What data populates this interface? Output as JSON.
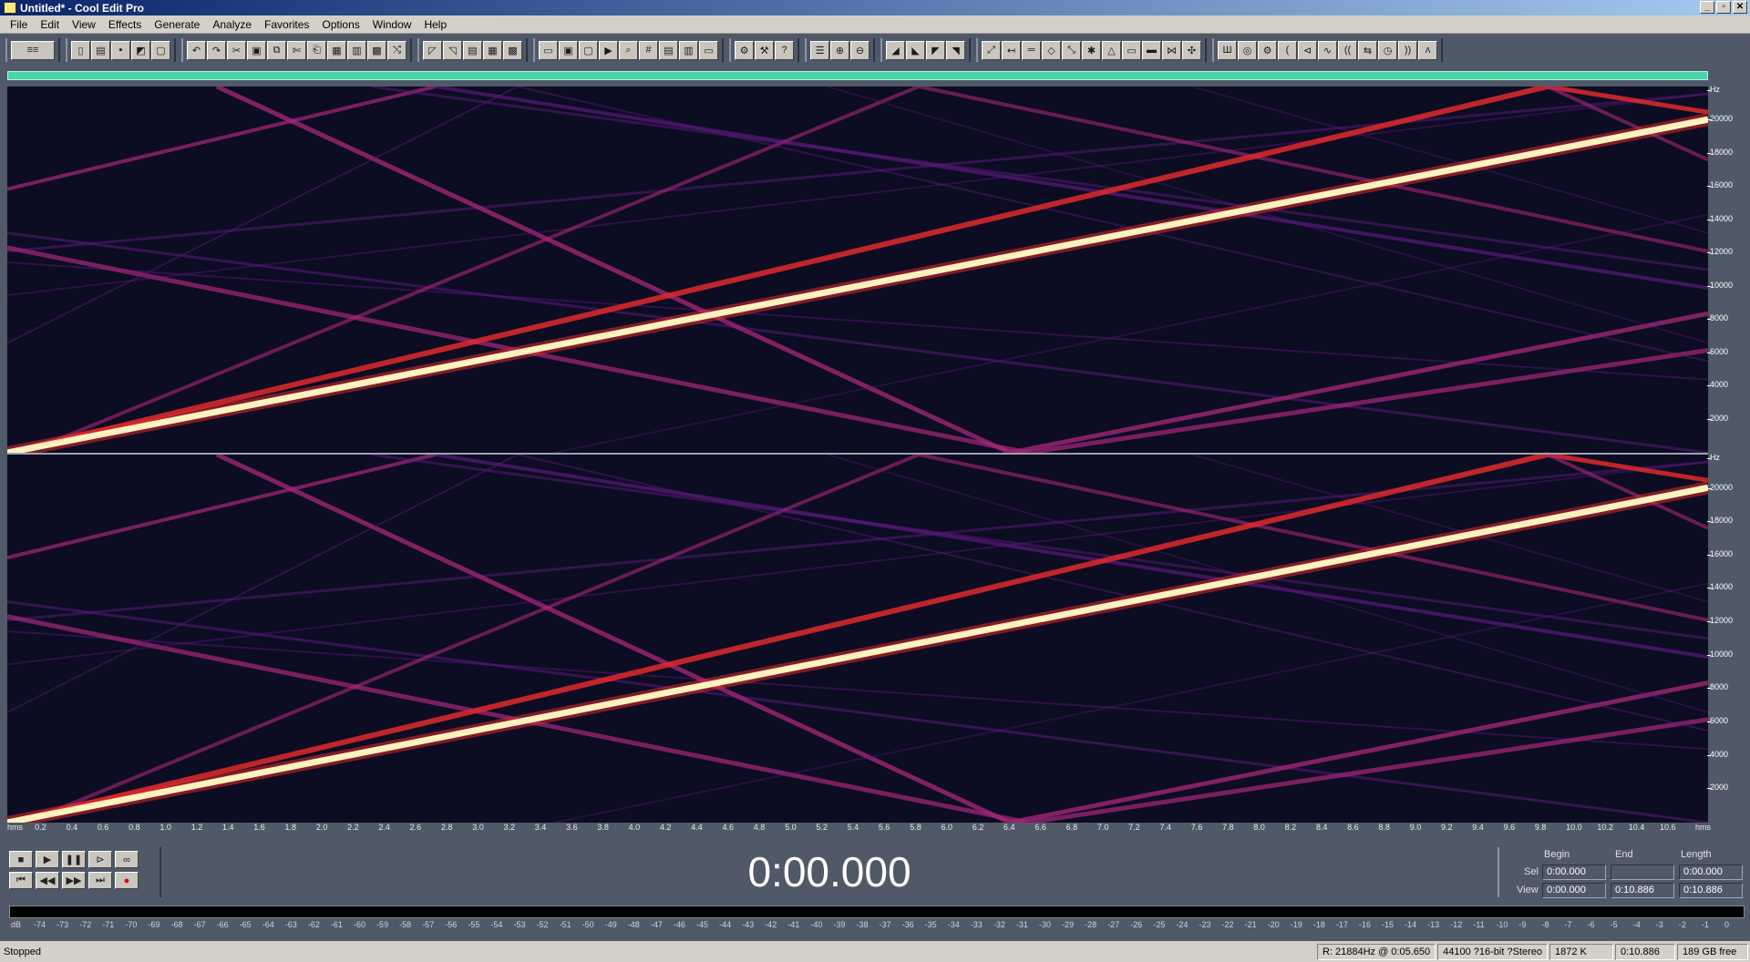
{
  "window": {
    "title": "Untitled* - Cool Edit Pro",
    "min": "_",
    "restore": "▫",
    "close": "✕"
  },
  "menu": [
    "File",
    "Edit",
    "View",
    "Effects",
    "Generate",
    "Analyze",
    "Favorites",
    "Options",
    "Window",
    "Help"
  ],
  "toolbar_groups": [
    [
      {
        "icon": "multitrack-icon",
        "glyph": "≡≡"
      }
    ],
    [
      {
        "icon": "new-file-icon",
        "glyph": "▯"
      },
      {
        "icon": "open-file-icon",
        "glyph": "▤"
      },
      {
        "icon": "save-icon",
        "glyph": "▪"
      },
      {
        "icon": "save-as-icon",
        "glyph": "◩"
      },
      {
        "icon": "close-file-icon",
        "glyph": "▢"
      }
    ],
    [
      {
        "icon": "undo-icon",
        "glyph": "↶"
      },
      {
        "icon": "redo-icon",
        "glyph": "↷"
      },
      {
        "icon": "cut-icon",
        "glyph": "✂"
      },
      {
        "icon": "copy-icon",
        "glyph": "▣"
      },
      {
        "icon": "copy-new-icon",
        "glyph": "⧉"
      },
      {
        "icon": "trim-icon",
        "glyph": "✄"
      },
      {
        "icon": "paste-icon",
        "glyph": "⎗"
      },
      {
        "icon": "paste-new-icon",
        "glyph": "▦"
      },
      {
        "icon": "mix-paste-icon",
        "glyph": "▥"
      },
      {
        "icon": "clipboard-icon",
        "glyph": "▩"
      },
      {
        "icon": "mix-icon",
        "glyph": "⤭"
      }
    ],
    [
      {
        "icon": "envelope-icon",
        "glyph": "◸"
      },
      {
        "icon": "fade-icon",
        "glyph": "◹"
      },
      {
        "icon": "split-icon",
        "glyph": "▤"
      },
      {
        "icon": "channel-icon",
        "glyph": "▦"
      },
      {
        "icon": "grid-icon",
        "glyph": "▩"
      }
    ],
    [
      {
        "icon": "view-waveform-icon",
        "glyph": "▭"
      },
      {
        "icon": "view-spectral-icon",
        "glyph": "▣"
      },
      {
        "icon": "view-info-icon",
        "glyph": "▢"
      },
      {
        "icon": "play-preview-icon",
        "glyph": "▶"
      },
      {
        "icon": "zoom-tool-icon",
        "glyph": "⌕"
      },
      {
        "icon": "sample-rate-icon",
        "glyph": "#"
      },
      {
        "icon": "bit-depth-icon",
        "glyph": "▤"
      },
      {
        "icon": "stats-icon",
        "glyph": "▥"
      },
      {
        "icon": "blank-icon",
        "glyph": "▭"
      }
    ],
    [
      {
        "icon": "settings-icon",
        "glyph": "⚙"
      },
      {
        "icon": "tools-icon",
        "glyph": "⚒"
      },
      {
        "icon": "help-icon",
        "glyph": "?"
      }
    ],
    [
      {
        "icon": "list-icon",
        "glyph": "☰"
      },
      {
        "icon": "zoom-in-icon",
        "glyph": "⊕"
      },
      {
        "icon": "zoom-out-icon",
        "glyph": "⊖"
      }
    ],
    [
      {
        "icon": "effect-a-icon",
        "glyph": "◢"
      },
      {
        "icon": "effect-b-icon",
        "glyph": "◣"
      },
      {
        "icon": "effect-c-icon",
        "glyph": "◤"
      },
      {
        "icon": "effect-d-icon",
        "glyph": "◥"
      }
    ],
    [
      {
        "icon": "tool-a-icon",
        "glyph": "⤢"
      },
      {
        "icon": "tool-b-icon",
        "glyph": "↤"
      },
      {
        "icon": "tool-c-icon",
        "glyph": "═"
      },
      {
        "icon": "tool-d-icon",
        "glyph": "◇"
      },
      {
        "icon": "tool-e-icon",
        "glyph": "⤡"
      },
      {
        "icon": "tool-f-icon",
        "glyph": "✱"
      },
      {
        "icon": "tool-g-icon",
        "glyph": "△"
      },
      {
        "icon": "tool-h-icon",
        "glyph": "▭"
      },
      {
        "icon": "tool-i-icon",
        "glyph": "▬"
      },
      {
        "icon": "tool-j-icon",
        "glyph": "⋈"
      },
      {
        "icon": "tool-k-icon",
        "glyph": "✣"
      }
    ],
    [
      {
        "icon": "analyze-a-icon",
        "glyph": "Ш"
      },
      {
        "icon": "analyze-b-icon",
        "glyph": "◎"
      },
      {
        "icon": "analyze-c-icon",
        "glyph": "⚙"
      },
      {
        "icon": "analyze-d-icon",
        "glyph": "("
      },
      {
        "icon": "analyze-e-icon",
        "glyph": "⊲"
      },
      {
        "icon": "analyze-f-icon",
        "glyph": "∿"
      },
      {
        "icon": "analyze-g-icon",
        "glyph": "(("
      },
      {
        "icon": "analyze-h-icon",
        "glyph": "⇆"
      },
      {
        "icon": "analyze-i-icon",
        "glyph": "◷"
      },
      {
        "icon": "analyze-j-icon",
        "glyph": "))"
      },
      {
        "icon": "analyze-k-icon",
        "glyph": "ʌ"
      }
    ]
  ],
  "y_axis": {
    "unit": "Hz",
    "ticks": [
      "20000",
      "18000",
      "16000",
      "14000",
      "12000",
      "10000",
      "8000",
      "6000",
      "4000",
      "2000"
    ]
  },
  "x_axis": {
    "ticks": [
      "hms",
      "0.2",
      "0.4",
      "0.6",
      "0.8",
      "1.0",
      "1.2",
      "1.4",
      "1.6",
      "1.8",
      "2.0",
      "2.2",
      "2.4",
      "2.6",
      "2.8",
      "3.0",
      "3.2",
      "3.4",
      "3.6",
      "3.8",
      "4.0",
      "4.2",
      "4.4",
      "4.6",
      "4.8",
      "5.0",
      "5.2",
      "5.4",
      "5.6",
      "5.8",
      "6.0",
      "6.2",
      "6.4",
      "6.6",
      "6.8",
      "7.0",
      "7.2",
      "7.4",
      "7.6",
      "7.8",
      "8.0",
      "8.2",
      "8.4",
      "8.6",
      "8.8",
      "9.0",
      "9.2",
      "9.4",
      "9.6",
      "9.8",
      "10.0",
      "10.2",
      "10.4",
      "10.6",
      "hms"
    ]
  },
  "spectrogram": {
    "duration_s": 10.886,
    "max_hz": 22050,
    "colors": {
      "bg": "#0c0c22",
      "weak": "#5a1a7a",
      "mid": "#a8287a",
      "strong": "#e02a2a",
      "hot": "#fff2c0"
    }
  },
  "transport": {
    "row1": [
      {
        "icon": "stop-icon",
        "glyph": "■"
      },
      {
        "icon": "play-icon",
        "glyph": "▶"
      },
      {
        "icon": "pause-icon",
        "glyph": "❚❚"
      },
      {
        "icon": "play-to-end-icon",
        "glyph": "⊳"
      },
      {
        "icon": "loop-icon",
        "glyph": "∞"
      }
    ],
    "row2": [
      {
        "icon": "go-start-icon",
        "glyph": "⏮"
      },
      {
        "icon": "rewind-icon",
        "glyph": "◀◀"
      },
      {
        "icon": "forward-icon",
        "glyph": "▶▶"
      },
      {
        "icon": "go-end-icon",
        "glyph": "⏭"
      },
      {
        "icon": "record-icon",
        "glyph": "●"
      }
    ]
  },
  "time_display": "0:00.000",
  "selection": {
    "headers": {
      "begin": "Begin",
      "end": "End",
      "length": "Length"
    },
    "sel": {
      "label": "Sel",
      "begin": "0:00.000",
      "end": "",
      "length": "0:00.000"
    },
    "view": {
      "label": "View",
      "begin": "0:00.000",
      "end": "0:10.886",
      "length": "0:10.886"
    }
  },
  "level_meter": {
    "ticks": [
      "dB",
      "-74",
      "-73",
      "-72",
      "-71",
      "-70",
      "-69",
      "-68",
      "-67",
      "-66",
      "-65",
      "-64",
      "-63",
      "-62",
      "-61",
      "-60",
      "-59",
      "-58",
      "-57",
      "-56",
      "-55",
      "-54",
      "-53",
      "-52",
      "-51",
      "-50",
      "-49",
      "-48",
      "-47",
      "-46",
      "-45",
      "-44",
      "-43",
      "-42",
      "-41",
      "-40",
      "-39",
      "-38",
      "-37",
      "-36",
      "-35",
      "-34",
      "-33",
      "-32",
      "-31",
      "-30",
      "-29",
      "-28",
      "-27",
      "-26",
      "-25",
      "-24",
      "-23",
      "-22",
      "-21",
      "-20",
      "-19",
      "-18",
      "-17",
      "-16",
      "-15",
      "-14",
      "-13",
      "-12",
      "-11",
      "-10",
      "-9",
      "-8",
      "-7",
      "-6",
      "-5",
      "-4",
      "-3",
      "-2",
      "-1",
      "0"
    ]
  },
  "status": {
    "state": "Stopped",
    "cursor": "R: 21884Hz @   0:05.650",
    "format": "44100 ?16-bit ?Stereo",
    "size": "1872 K",
    "duration": "0:10.886",
    "free": "189 GB free"
  }
}
